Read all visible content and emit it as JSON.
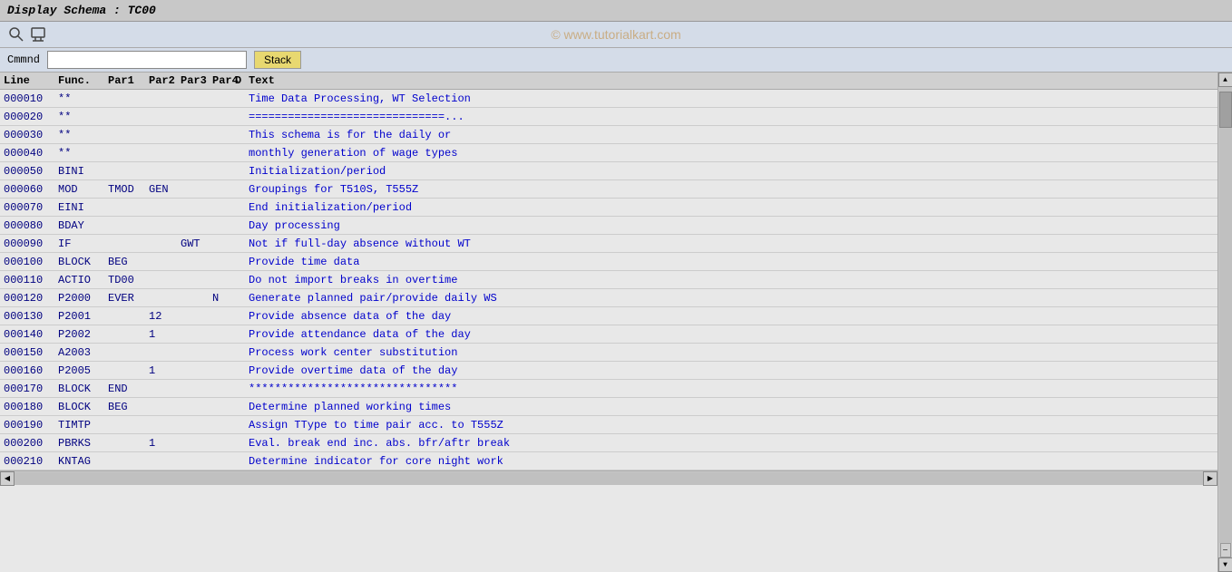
{
  "title": "Display Schema : TC00",
  "watermark": "© www.tutorialkart.com",
  "toolbar": {
    "icon1": "🔧",
    "icon2": "📌"
  },
  "command": {
    "label": "Cmmnd",
    "placeholder": "",
    "stack_button": "Stack"
  },
  "table": {
    "headers": {
      "line": "Line",
      "func": "Func.",
      "par1": "Par1",
      "par2": "Par2",
      "par3": "Par3",
      "par4": "Par4",
      "d": "D",
      "text": "Text"
    },
    "rows": [
      {
        "line": "000010",
        "func": "**",
        "par1": "",
        "par2": "",
        "par3": "",
        "par4": "",
        "d": "",
        "text": "Time Data Processing, WT Selection"
      },
      {
        "line": "000020",
        "func": "**",
        "par1": "",
        "par2": "",
        "par3": "",
        "par4": "",
        "d": "",
        "text": "==============================..."
      },
      {
        "line": "000030",
        "func": "**",
        "par1": "",
        "par2": "",
        "par3": "",
        "par4": "",
        "d": "",
        "text": "This schema is for the daily or"
      },
      {
        "line": "000040",
        "func": "**",
        "par1": "",
        "par2": "",
        "par3": "",
        "par4": "",
        "d": "",
        "text": "monthly generation of wage types"
      },
      {
        "line": "000050",
        "func": "BINI",
        "par1": "",
        "par2": "",
        "par3": "",
        "par4": "",
        "d": "",
        "text": "Initialization/period"
      },
      {
        "line": "000060",
        "func": "MOD",
        "par1": "TMOD",
        "par2": "GEN",
        "par3": "",
        "par4": "",
        "d": "",
        "text": "Groupings for T510S, T555Z"
      },
      {
        "line": "000070",
        "func": "EINI",
        "par1": "",
        "par2": "",
        "par3": "",
        "par4": "",
        "d": "",
        "text": "End initialization/period"
      },
      {
        "line": "000080",
        "func": "BDAY",
        "par1": "",
        "par2": "",
        "par3": "",
        "par4": "",
        "d": "",
        "text": "Day processing"
      },
      {
        "line": "000090",
        "func": "IF",
        "par1": "",
        "par2": "",
        "par3": "GWT",
        "par4": "",
        "d": "",
        "text": "Not if full-day absence without WT"
      },
      {
        "line": "000100",
        "func": "BLOCK",
        "par1": "BEG",
        "par2": "",
        "par3": "",
        "par4": "",
        "d": "",
        "text": "Provide time data"
      },
      {
        "line": "000110",
        "func": "ACTIO",
        "par1": "TD00",
        "par2": "",
        "par3": "",
        "par4": "",
        "d": "",
        "text": "Do not import breaks in overtime"
      },
      {
        "line": "000120",
        "func": "P2000",
        "par1": "EVER",
        "par2": "",
        "par3": "",
        "par4": "N",
        "d": "",
        "text": "Generate planned pair/provide daily WS"
      },
      {
        "line": "000130",
        "func": "P2001",
        "par1": "",
        "par2": "12",
        "par3": "",
        "par4": "",
        "d": "",
        "text": "Provide absence data of the day"
      },
      {
        "line": "000140",
        "func": "P2002",
        "par1": "",
        "par2": "1",
        "par3": "",
        "par4": "",
        "d": "",
        "text": "Provide attendance data of the day"
      },
      {
        "line": "000150",
        "func": "A2003",
        "par1": "",
        "par2": "",
        "par3": "",
        "par4": "",
        "d": "",
        "text": "Process work center substitution"
      },
      {
        "line": "000160",
        "func": "P2005",
        "par1": "",
        "par2": "1",
        "par3": "",
        "par4": "",
        "d": "",
        "text": "Provide overtime data of the day"
      },
      {
        "line": "000170",
        "func": "BLOCK",
        "par1": "END",
        "par2": "",
        "par3": "",
        "par4": "",
        "d": "",
        "text": "********************************"
      },
      {
        "line": "000180",
        "func": "BLOCK",
        "par1": "BEG",
        "par2": "",
        "par3": "",
        "par4": "",
        "d": "",
        "text": "Determine planned working times"
      },
      {
        "line": "000190",
        "func": "TIMTP",
        "par1": "",
        "par2": "",
        "par3": "",
        "par4": "",
        "d": "",
        "text": "Assign TType to time pair acc. to T555Z"
      },
      {
        "line": "000200",
        "func": "PBRKS",
        "par1": "",
        "par2": "1",
        "par3": "",
        "par4": "",
        "d": "",
        "text": "Eval. break end inc. abs. bfr/aftr break"
      },
      {
        "line": "000210",
        "func": "KNTAG",
        "par1": "",
        "par2": "",
        "par3": "",
        "par4": "",
        "d": "",
        "text": "Determine indicator for core night work"
      }
    ]
  }
}
